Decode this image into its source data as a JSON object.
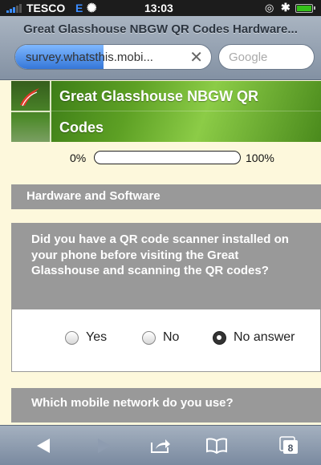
{
  "status_bar": {
    "carrier": "TESCO",
    "network": "E",
    "time": "13:03"
  },
  "browser": {
    "page_title": "Great Glasshouse NBGW QR Codes Hardware...",
    "url": "survey.whatsthis.mobi...",
    "search_placeholder": "Google",
    "load_progress": 0.45
  },
  "banner": {
    "title_line1": "Great Glasshouse NBGW QR",
    "title_line2": "Codes"
  },
  "progress": {
    "min_label": "0%",
    "max_label": "100%",
    "value": 0.0
  },
  "section": {
    "title": "Hardware and Software"
  },
  "question1": {
    "text": "Did you have a QR code scanner installed on your phone before visiting the Great Glasshouse and scanning the QR codes?",
    "options": [
      "Yes",
      "No",
      "No answer"
    ],
    "selected": "No answer"
  },
  "question2": {
    "text": "Which mobile network do you use?"
  },
  "toolbar": {
    "tabs_count": "8",
    "back_icon": "back-arrow-icon",
    "forward_icon": "forward-arrow-icon",
    "share_icon": "share-icon",
    "bookmarks_icon": "bookmarks-icon",
    "tabs_icon": "tabs-icon"
  },
  "colors": {
    "accent_blue": "#3b8cff",
    "section_gray": "#999999",
    "page_bg": "#fdf8dc",
    "banner_green": "#5da024"
  }
}
